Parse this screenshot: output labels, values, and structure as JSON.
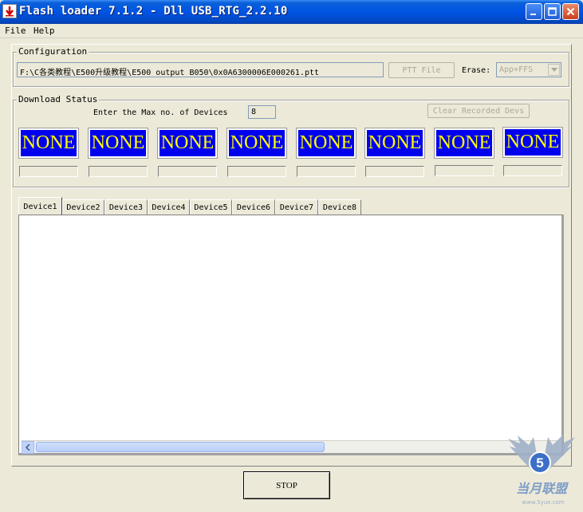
{
  "window": {
    "title": "Flash loader 7.1.2 - Dll USB_RTG_2.2.10"
  },
  "menu": [
    "File",
    "Help"
  ],
  "configuration": {
    "label": "Configuration",
    "path": "F:\\C各类教程\\E500升级教程\\E500_output_B050\\0x0A6300006E000261.ptt",
    "ptt_button": "PTT File",
    "erase_label": "Erase:",
    "erase_value": "App+FFS"
  },
  "download_status": {
    "label": "Download Status",
    "max_devices_label": "Enter the Max no. of Devices",
    "max_devices_value": "8",
    "clear_button": "Clear Recorded Devs",
    "devices": [
      "NONE",
      "NONE",
      "NONE",
      "NONE",
      "NONE",
      "NONE",
      "NONE",
      "NONE"
    ]
  },
  "tabs": [
    "Device1",
    "Device2",
    "Device3",
    "Device4",
    "Device5",
    "Device6",
    "Device7",
    "Device8"
  ],
  "stop_button": "STOP",
  "watermark": {
    "text": "当月联盟",
    "url": "www.5yue.com"
  },
  "colors": {
    "status_bg": "#0000ee",
    "status_text": "#ffff00",
    "titlebar": "#0054e3"
  }
}
